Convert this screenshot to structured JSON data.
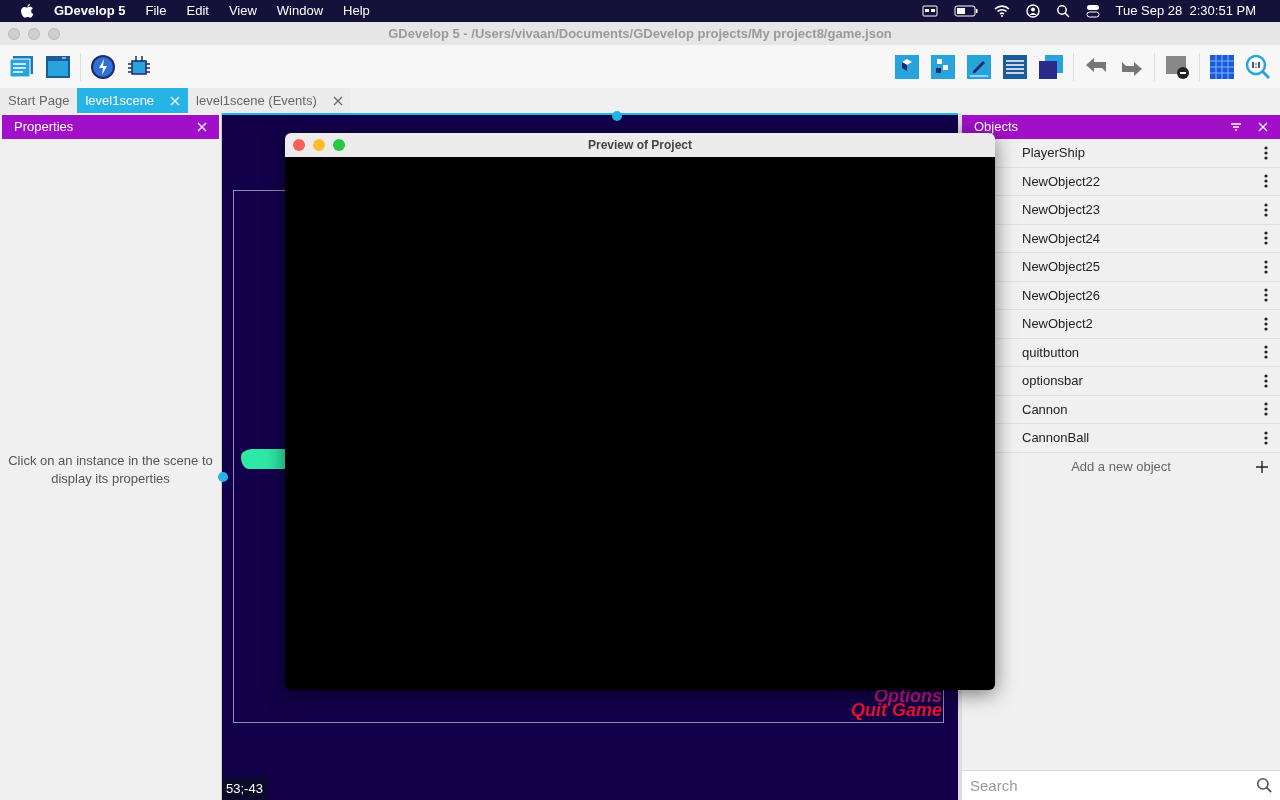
{
  "menu_bar": {
    "app_name": "GDevelop 5",
    "menus": [
      "File",
      "Edit",
      "View",
      "Window",
      "Help"
    ],
    "clock": "Tue Sep 28  2:30:51 PM"
  },
  "window": {
    "title": "GDevelop 5 - /Users/vivaan/Documents/GDevelop projects/My project8/game.json"
  },
  "tabs": [
    {
      "label": "Start Page",
      "selected": false,
      "closable": false
    },
    {
      "label": "level1scene",
      "selected": true,
      "closable": true
    },
    {
      "label": "level1scene (Events)",
      "selected": false,
      "closable": true
    }
  ],
  "properties_panel": {
    "title": "Properties",
    "message": "Click on an instance in the scene to display its properties"
  },
  "scene": {
    "texts": [
      "Options",
      "Quit Game"
    ],
    "coordinates": "53;-43"
  },
  "preview_window": {
    "title": "Preview of Project"
  },
  "objects_panel": {
    "title": "Objects",
    "items": [
      "PlayerShip",
      "NewObject22",
      "NewObject23",
      "NewObject24",
      "NewObject25",
      "NewObject26",
      "NewObject2",
      "quitbutton",
      "optionsbar",
      "Cannon",
      "CannonBall"
    ],
    "add_label": "Add a new object",
    "search": {
      "placeholder": "Search"
    }
  }
}
